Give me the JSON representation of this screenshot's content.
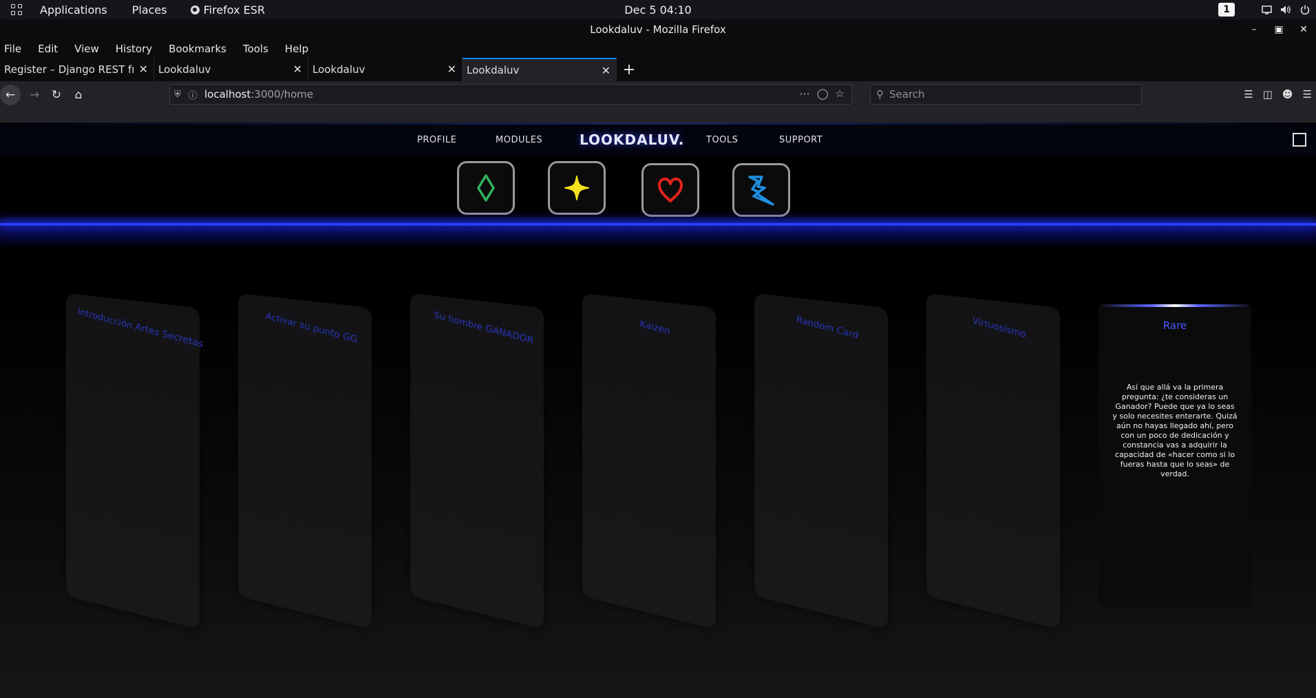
{
  "system_bar": {
    "applications": "Applications",
    "places": "Places",
    "app_name": "Firefox ESR",
    "clock": "Dec 5  04:10",
    "workspace": "1"
  },
  "window": {
    "title": "Lookdaluv - Mozilla Firefox"
  },
  "menu": [
    "File",
    "Edit",
    "View",
    "History",
    "Bookmarks",
    "Tools",
    "Help"
  ],
  "tabs": [
    {
      "title": "Register – Django REST framework"
    },
    {
      "title": "Lookdaluv"
    },
    {
      "title": "Lookdaluv"
    },
    {
      "title": "Lookdaluv",
      "active": true
    }
  ],
  "url": {
    "host": "localhost",
    "path": ":3000/home"
  },
  "search": {
    "placeholder": "Search"
  },
  "site": {
    "nav": {
      "profile": "PROFILE",
      "modules": "MODULES",
      "brand": "LOOKDALUV.",
      "tools": "TOOLS",
      "support": "SUPPORT"
    },
    "suits": [
      {
        "icon": "diamond-icon",
        "color": "#2fb35a"
      },
      {
        "icon": "star-icon",
        "color": "#f4e21c"
      },
      {
        "icon": "heart-icon",
        "color": "#e0241e"
      },
      {
        "icon": "lightning-icon",
        "color": "#1e8fe0"
      }
    ],
    "cards": [
      {
        "title": "Introducción Artes Secretas"
      },
      {
        "title": "Activar su punto GG"
      },
      {
        "title": "Su hombre GANADOR"
      },
      {
        "title": "Kaizen"
      },
      {
        "title": "Random Card"
      },
      {
        "title": "Virtuosismo"
      }
    ],
    "info_card": {
      "rarity": "Rare",
      "text": "Así que allá va la primera pregunta: ¿te consideras un Ganador? Puede que ya lo seas y solo necesites enterarte. Quizá aún no hayas llegado ahí, pero con un poco de dedicación y constancia vas a adquirir la capacidad de «hacer como si lo fueras hasta que lo seas» de verdad."
    }
  }
}
